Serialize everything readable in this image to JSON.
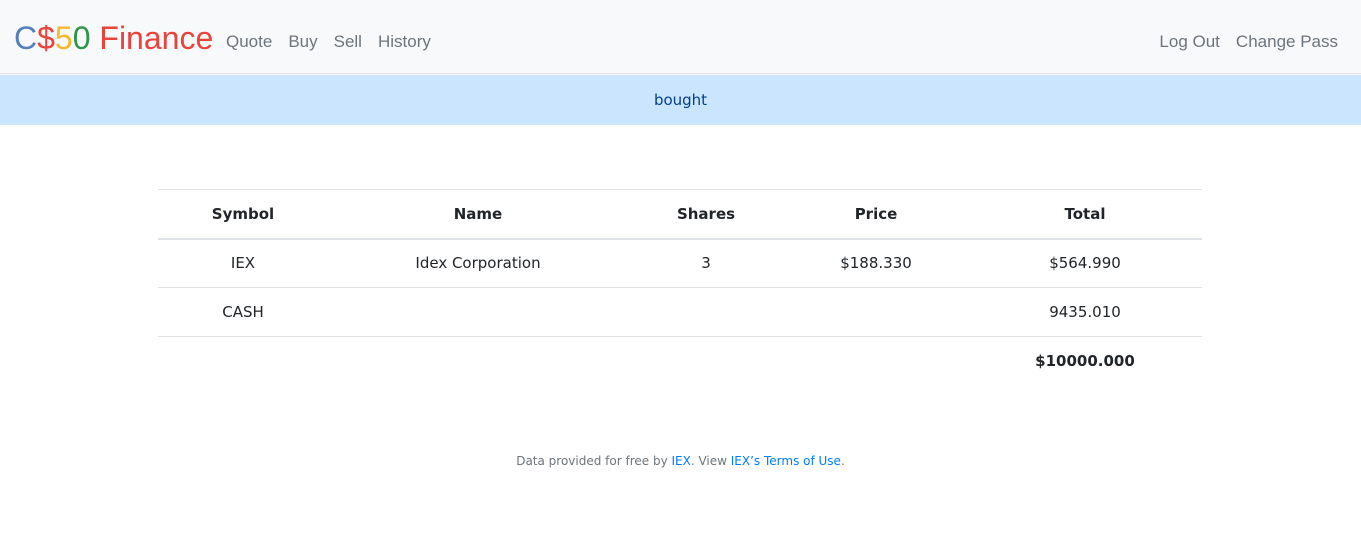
{
  "brand": {
    "letters": [
      {
        "char": "C",
        "color": "#537fbe"
      },
      {
        "char": "$",
        "color": "#ea433b"
      },
      {
        "char": "5",
        "color": "#f5b82e"
      },
      {
        "char": "0",
        "color": "#2e944b"
      },
      {
        "char": " Finance",
        "color": "#ea433b"
      }
    ]
  },
  "nav": {
    "left": [
      "Quote",
      "Buy",
      "Sell",
      "History"
    ],
    "right": [
      "Log Out",
      "Change Pass"
    ]
  },
  "alert": {
    "message": "bought"
  },
  "table": {
    "headers": {
      "symbol": "Symbol",
      "name": "Name",
      "shares": "Shares",
      "price": "Price",
      "total": "Total"
    },
    "rows": [
      {
        "symbol": "IEX",
        "name": "Idex Corporation",
        "shares": "3",
        "price": "$188.330",
        "total": "$564.990"
      },
      {
        "symbol": "CASH",
        "name": "",
        "shares": "",
        "price": "",
        "total": "9435.010"
      }
    ],
    "grand_total": "$10000.000"
  },
  "footer": {
    "prefix": "Data provided for free by ",
    "link1": "IEX",
    "middle": ". View ",
    "link2": "IEX’s Terms of Use",
    "suffix": "."
  }
}
